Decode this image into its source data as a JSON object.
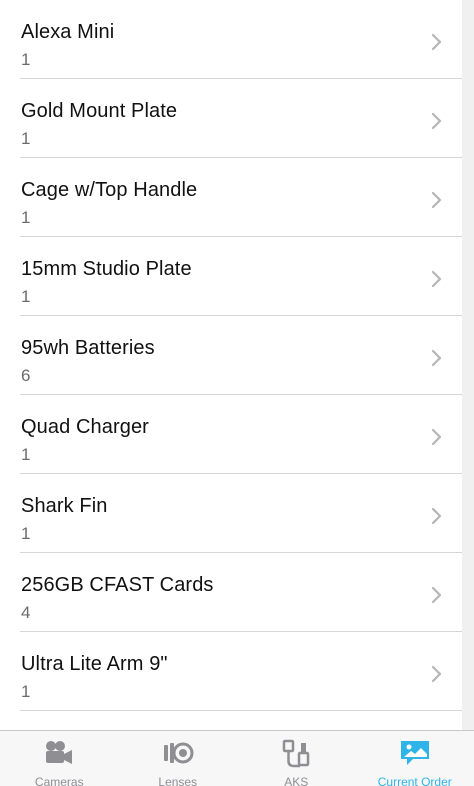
{
  "order_items": [
    {
      "name": "Alexa Mini",
      "qty": "1"
    },
    {
      "name": "Gold Mount Plate",
      "qty": "1"
    },
    {
      "name": "Cage w/Top Handle",
      "qty": "1"
    },
    {
      "name": "15mm Studio Plate",
      "qty": "1"
    },
    {
      "name": "95wh Batteries",
      "qty": "6"
    },
    {
      "name": "Quad Charger",
      "qty": "1"
    },
    {
      "name": "Shark Fin",
      "qty": "1"
    },
    {
      "name": "256GB CFAST Cards",
      "qty": "4"
    },
    {
      "name": "Ultra Lite Arm 9\"",
      "qty": "1"
    }
  ],
  "tabs": [
    {
      "label": "Cameras",
      "icon": "video-camera-icon",
      "active": false
    },
    {
      "label": "Lenses",
      "icon": "lens-icon",
      "active": false
    },
    {
      "label": "AKS",
      "icon": "cable-icon",
      "active": false
    },
    {
      "label": "Current Order",
      "icon": "image-chat-icon",
      "active": true
    }
  ],
  "colors": {
    "accent": "#2fb4e8",
    "inactive_tab": "#8e8e93",
    "separator": "#d6d6d8"
  }
}
